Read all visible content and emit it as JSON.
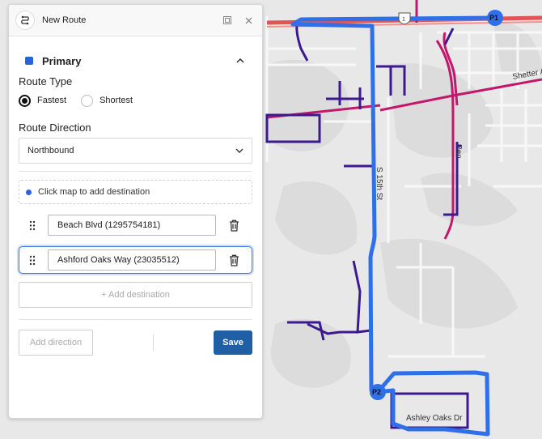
{
  "map": {
    "labels": {
      "street_15th": "S 15th St",
      "shetter": "Shetter A",
      "ashley_oaks": "Ashley Oaks Dr",
      "penman": "Pen",
      "highway_shield": "1"
    },
    "pins": {
      "start": "P1",
      "end": "P2"
    },
    "colors": {
      "route": "#2f6fe8",
      "primary_road": "#c2186b",
      "secondary_road": "#3b1a8f",
      "highway": "#e35555"
    }
  },
  "panel": {
    "title": "New Route",
    "route_name": "Primary",
    "route_color": "#2a62d9",
    "route_type_label": "Route Type",
    "route_types": [
      {
        "label": "Fastest",
        "checked": true
      },
      {
        "label": "Shortest",
        "checked": false
      }
    ],
    "route_direction_label": "Route Direction",
    "route_direction_value": "Northbound",
    "hint": "Click map to add destination",
    "destinations": [
      {
        "value": "Beach Blvd (1295754181)"
      },
      {
        "value": "Ashford Oaks Way (23035512)"
      }
    ],
    "add_destination": "+ Add destination",
    "add_direction": "Add direction",
    "save": "Save"
  }
}
